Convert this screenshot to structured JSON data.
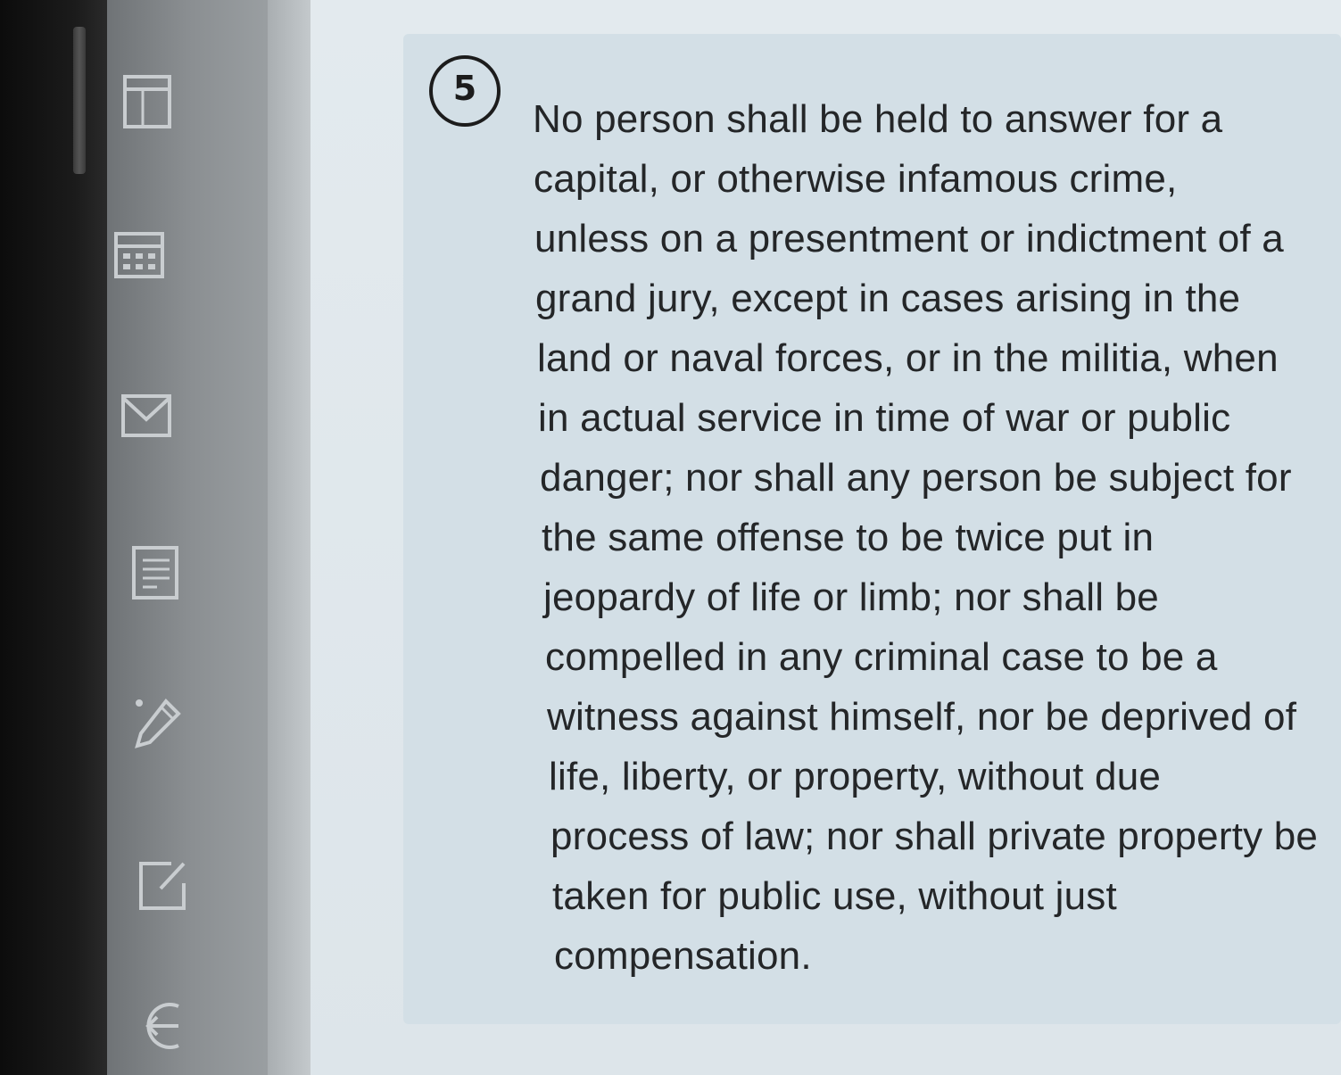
{
  "sidebar": {
    "icons": [
      {
        "name": "table-icon"
      },
      {
        "name": "calendar-icon"
      },
      {
        "name": "mail-icon"
      },
      {
        "name": "notes-icon"
      },
      {
        "name": "pencil-icon"
      },
      {
        "name": "edit-icon"
      },
      {
        "name": "logout-icon"
      }
    ]
  },
  "content": {
    "step_number": "5",
    "lines": [
      "No person shall be held to answer for a",
      "capital, or otherwise infamous crime,",
      "unless on a presentment or indictment of a",
      "grand jury, except in cases arising in the",
      "land or naval forces, or in the militia, when",
      "in actual service in time of war or public",
      "danger; nor shall any person be subject for",
      "the same offense to be twice put in",
      "jeopardy of life or limb; nor shall be",
      "compelled in any criminal case to be a",
      "witness against himself, nor be deprived of",
      "life, liberty, or property, without due",
      "process of law; nor shall private property be",
      "taken for public use, without just",
      "compensation."
    ]
  },
  "colors": {
    "text": "#242628",
    "card": "#d3dfe6",
    "sidebar": "#8a8e91"
  }
}
